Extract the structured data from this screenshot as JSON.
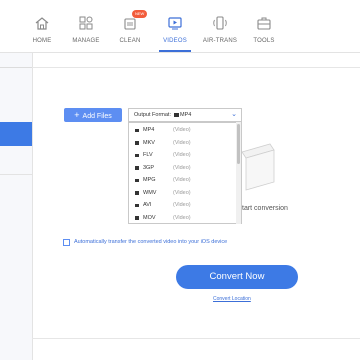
{
  "nav": {
    "items": [
      {
        "label": "HOME",
        "icon": "home-icon"
      },
      {
        "label": "MANAGE",
        "icon": "manage-icon"
      },
      {
        "label": "CLEAN",
        "icon": "clean-icon",
        "badge": "NEW"
      },
      {
        "label": "VIDEOS",
        "icon": "video-icon",
        "active": true
      },
      {
        "label": "AIR-TRANS",
        "icon": "air-trans-icon"
      },
      {
        "label": "TOOLS",
        "icon": "tools-icon"
      }
    ]
  },
  "main": {
    "add_files_label": "Add Files",
    "output_format_label": "Output Format:",
    "selected_format": "MP4",
    "drop_hint": "tart conversion",
    "auto_transfer_label": "Automatically transfer the converted video into your iOS device",
    "convert_label": "Convert Now",
    "convert_location_label": "Convert Location"
  },
  "formats": [
    {
      "name": "MP4",
      "type": "(Video)"
    },
    {
      "name": "MKV",
      "type": "(Video)"
    },
    {
      "name": "FLV",
      "type": "(Video)"
    },
    {
      "name": "3GP",
      "type": "(Video)"
    },
    {
      "name": "MPG",
      "type": "(Video)"
    },
    {
      "name": "WMV",
      "type": "(Video)"
    },
    {
      "name": "AVI",
      "type": "(Video)"
    },
    {
      "name": "MOV",
      "type": "(Video)"
    }
  ],
  "colors": {
    "accent": "#3d7ae5",
    "badge": "#f25c3b"
  }
}
